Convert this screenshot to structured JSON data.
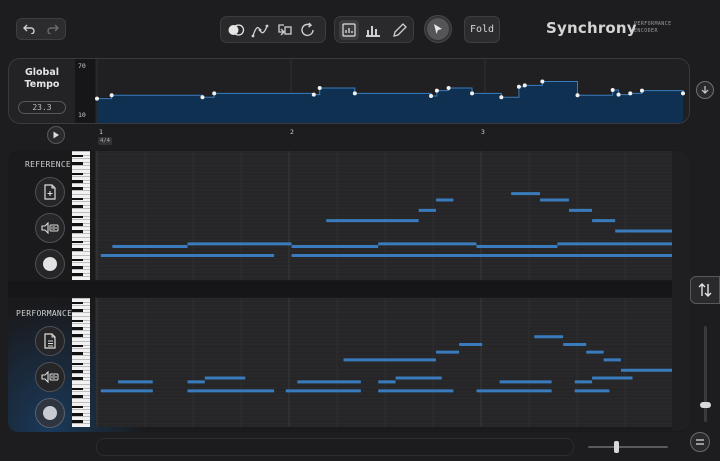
{
  "app": {
    "brand_name": "Synchrony",
    "brand_sub_line1": "PERFORMANCE",
    "brand_sub_line2": "ENCODER"
  },
  "toolbar": {
    "undo_icon": "undo-icon",
    "redo_icon": "redo-icon",
    "tool_icons": [
      "overlap-circles-icon",
      "curve-nodes-icon",
      "align-arrow-icon",
      "reset-loop-icon"
    ],
    "view_icons": [
      "grid-view-icon",
      "bar-chart-icon",
      "pencil-icon"
    ],
    "fold_label": "Fold"
  },
  "tempo": {
    "title_line1": "Global",
    "title_line2": "Tempo",
    "value": "23.3",
    "y_max_label": "70",
    "y_min_label": "10"
  },
  "timeline": {
    "bar_labels": [
      "1",
      "2",
      "3"
    ],
    "time_signature": "4/4"
  },
  "lanes": {
    "reference_label": "REFERENCE",
    "performance_label": "PERFORMANCE"
  },
  "colors": {
    "accent": "#3a7bbd",
    "background": "#1d1d1f",
    "grid_bg": "#262628",
    "note": "#3a7bbd"
  },
  "tempo_curve": [
    [
      0.0,
      0.4
    ],
    [
      0.025,
      0.45
    ],
    [
      0.18,
      0.42
    ],
    [
      0.2,
      0.48
    ],
    [
      0.37,
      0.46
    ],
    [
      0.38,
      0.56
    ],
    [
      0.44,
      0.48
    ],
    [
      0.57,
      0.44
    ],
    [
      0.58,
      0.52
    ],
    [
      0.6,
      0.56
    ],
    [
      0.64,
      0.48
    ],
    [
      0.69,
      0.42
    ],
    [
      0.72,
      0.58
    ],
    [
      0.73,
      0.6
    ],
    [
      0.76,
      0.66
    ],
    [
      0.82,
      0.45
    ],
    [
      0.88,
      0.53
    ],
    [
      0.89,
      0.46
    ],
    [
      0.91,
      0.48
    ],
    [
      0.93,
      0.52
    ],
    [
      1.0,
      0.48
    ]
  ],
  "reference_notes": [
    [
      0.01,
      0.31,
      0.81
    ],
    [
      0.34,
      0.66,
      0.81
    ],
    [
      0.66,
      1.0,
      0.81
    ],
    [
      0.03,
      0.16,
      0.74
    ],
    [
      0.16,
      0.34,
      0.72
    ],
    [
      0.34,
      0.49,
      0.74
    ],
    [
      0.49,
      0.66,
      0.72
    ],
    [
      0.66,
      0.8,
      0.74
    ],
    [
      0.8,
      1.0,
      0.72
    ],
    [
      0.4,
      0.56,
      0.54
    ],
    [
      0.56,
      0.59,
      0.46
    ],
    [
      0.59,
      0.62,
      0.38
    ],
    [
      0.72,
      0.77,
      0.33
    ],
    [
      0.77,
      0.82,
      0.38
    ],
    [
      0.82,
      0.86,
      0.46
    ],
    [
      0.86,
      0.9,
      0.54
    ],
    [
      0.9,
      1.0,
      0.62
    ]
  ],
  "performance_notes": [
    [
      0.01,
      0.1,
      0.72
    ],
    [
      0.04,
      0.1,
      0.65
    ],
    [
      0.16,
      0.31,
      0.72
    ],
    [
      0.16,
      0.19,
      0.65
    ],
    [
      0.19,
      0.26,
      0.62
    ],
    [
      0.33,
      0.46,
      0.72
    ],
    [
      0.35,
      0.46,
      0.65
    ],
    [
      0.49,
      0.62,
      0.72
    ],
    [
      0.49,
      0.52,
      0.65
    ],
    [
      0.52,
      0.6,
      0.62
    ],
    [
      0.66,
      0.79,
      0.72
    ],
    [
      0.7,
      0.79,
      0.65
    ],
    [
      0.83,
      0.89,
      0.72
    ],
    [
      0.83,
      0.86,
      0.65
    ],
    [
      0.86,
      0.93,
      0.62
    ],
    [
      0.43,
      0.59,
      0.48
    ],
    [
      0.59,
      0.63,
      0.42
    ],
    [
      0.63,
      0.67,
      0.36
    ],
    [
      0.76,
      0.81,
      0.3
    ],
    [
      0.81,
      0.85,
      0.36
    ],
    [
      0.85,
      0.88,
      0.42
    ],
    [
      0.88,
      0.91,
      0.48
    ],
    [
      0.91,
      1.0,
      0.56
    ]
  ]
}
